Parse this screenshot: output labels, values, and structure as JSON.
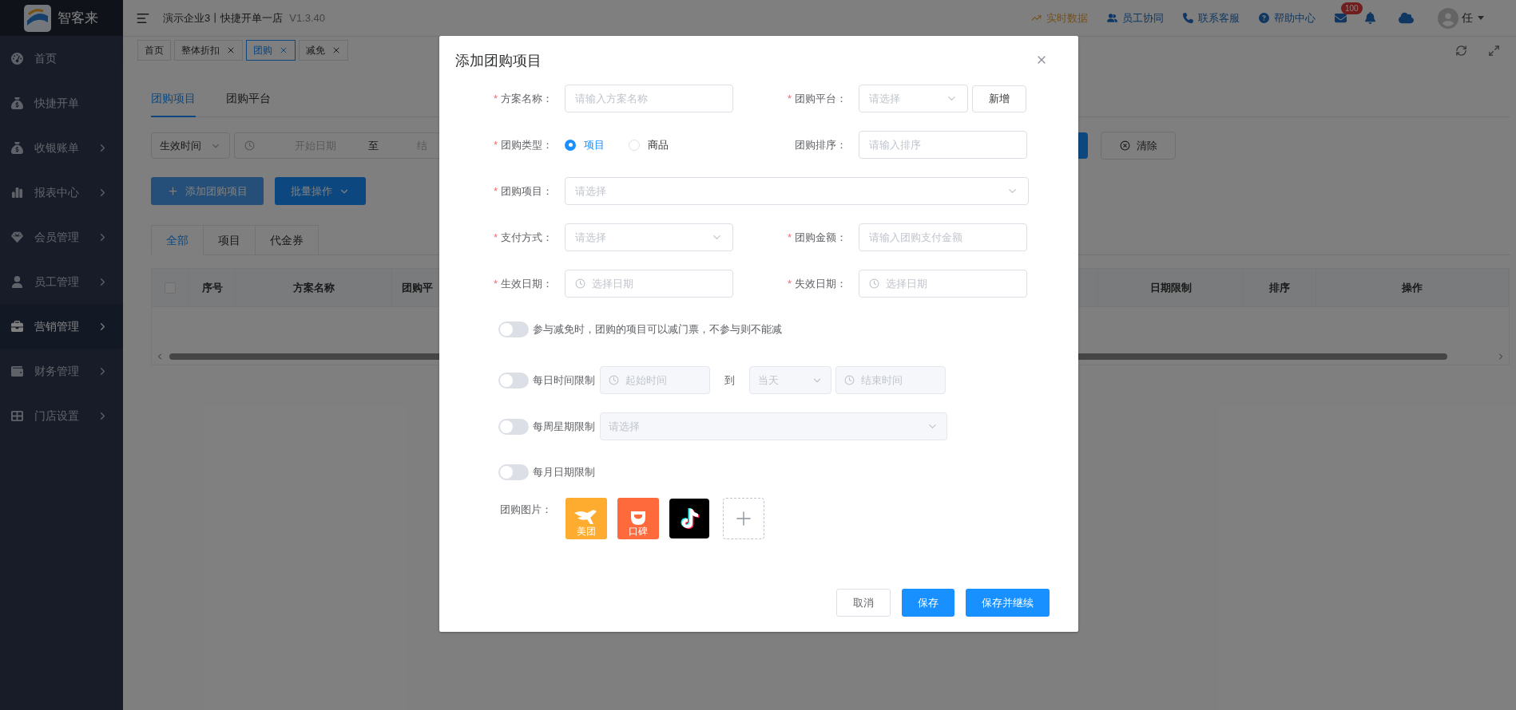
{
  "sidebar": {
    "brand": "智客来",
    "items": [
      {
        "label": "首页",
        "expandable": false,
        "selected": false
      },
      {
        "label": "快捷开单",
        "expandable": false,
        "selected": false
      },
      {
        "label": "收银账单",
        "expandable": true,
        "selected": false
      },
      {
        "label": "报表中心",
        "expandable": true,
        "selected": false
      },
      {
        "label": "会员管理",
        "expandable": true,
        "selected": false
      },
      {
        "label": "员工管理",
        "expandable": true,
        "selected": false
      },
      {
        "label": "营销管理",
        "expandable": true,
        "selected": true
      },
      {
        "label": "财务管理",
        "expandable": true,
        "selected": false
      },
      {
        "label": "门店设置",
        "expandable": true,
        "selected": false
      }
    ]
  },
  "top_bar": {
    "title": "演示企业3丨快捷开单一店",
    "version": "V1.3.40",
    "links": [
      {
        "label": "实时数据",
        "highlighted": true
      },
      {
        "label": "员工协同",
        "highlighted": false
      },
      {
        "label": "联系客服",
        "highlighted": false
      },
      {
        "label": "帮助中心",
        "highlighted": false
      }
    ],
    "mail_badge": "100",
    "user": "任"
  },
  "page_tabs": [
    {
      "label": "首页",
      "closable": false,
      "selected": false
    },
    {
      "label": "整体折扣",
      "closable": true,
      "selected": false
    },
    {
      "label": "团购",
      "closable": true,
      "selected": true
    },
    {
      "label": "减免",
      "closable": true,
      "selected": false
    }
  ],
  "sub_tabs": [
    {
      "label": "团购项目",
      "selected": true
    },
    {
      "label": "团购平台",
      "selected": false
    }
  ],
  "filter": {
    "field": "生效时间",
    "start_placeholder": "开始日期",
    "separator": "至",
    "end_placeholder": "结",
    "clear": "清除"
  },
  "actions": [
    {
      "label": "添加团购项目",
      "kind": "add"
    },
    {
      "label": "批量操作",
      "kind": "menu"
    }
  ],
  "type_tabs": [
    {
      "label": "全部",
      "selected": true
    },
    {
      "label": "项目",
      "selected": false
    },
    {
      "label": "代金券",
      "selected": false
    }
  ],
  "table": {
    "select_all_checked": false,
    "columns": [
      "序号",
      "方案名称",
      "团购平",
      "日期限制",
      "排序",
      "操作"
    ]
  },
  "dialog": {
    "title": "添加团购项目",
    "rows": [
      [
        {
          "mark": "*",
          "label": "方案名称：",
          "kind": "input",
          "placeholder": "请输入方案名称"
        },
        {
          "mark": "*",
          "label": "团购平台：",
          "kind": "select",
          "placeholder": "请选择",
          "button": "新增"
        }
      ],
      [
        {
          "mark": "*",
          "label": "团购类型：",
          "kind": "radio",
          "options": [
            {
              "label": "项目",
              "selected": true
            },
            {
              "label": "商品",
              "selected": false
            }
          ]
        },
        {
          "label": "团购排序：",
          "kind": "input",
          "placeholder": "请输入排序"
        }
      ],
      [
        {
          "mark": "*",
          "label": "团购项目：",
          "kind": "select",
          "placeholder": "请选择"
        }
      ],
      [
        {
          "mark": "*",
          "label": "支付方式：",
          "kind": "select",
          "placeholder": "请选择"
        },
        {
          "mark": "*",
          "label": "团购金额：",
          "kind": "input",
          "placeholder": "请输入团购支付金额"
        }
      ],
      [
        {
          "mark": "*",
          "label": "生效日期：",
          "kind": "date",
          "placeholder": "选择日期"
        },
        {
          "mark": "*",
          "label": "失效日期：",
          "kind": "date",
          "placeholder": "选择日期"
        }
      ]
    ],
    "switches": [
      {
        "label": "参与减免时，团购的项目可以减门票，不参与则不能减",
        "on": false,
        "kind": "plain"
      },
      {
        "label": "每日时间限制",
        "on": false,
        "kind": "time_range",
        "start_placeholder": "起始时间",
        "separator": "到",
        "day": "当天",
        "end_placeholder": "结束时间"
      },
      {
        "label": "每周星期限制",
        "on": false,
        "kind": "select",
        "placeholder": "请选择"
      },
      {
        "label": "每月日期限制",
        "on": false,
        "kind": "plain"
      }
    ],
    "images": {
      "label": "团购图片：",
      "items": [
        {
          "kind": "kangaroo",
          "caption": "美团"
        },
        {
          "kind": "smile",
          "caption": "口碑"
        },
        {
          "kind": "note"
        },
        {
          "kind": "add"
        }
      ]
    },
    "buttons": [
      {
        "label": "取消",
        "kind": "default"
      },
      {
        "label": "保存",
        "kind": "primary"
      },
      {
        "label": "保存并继续",
        "kind": "primary"
      }
    ]
  }
}
